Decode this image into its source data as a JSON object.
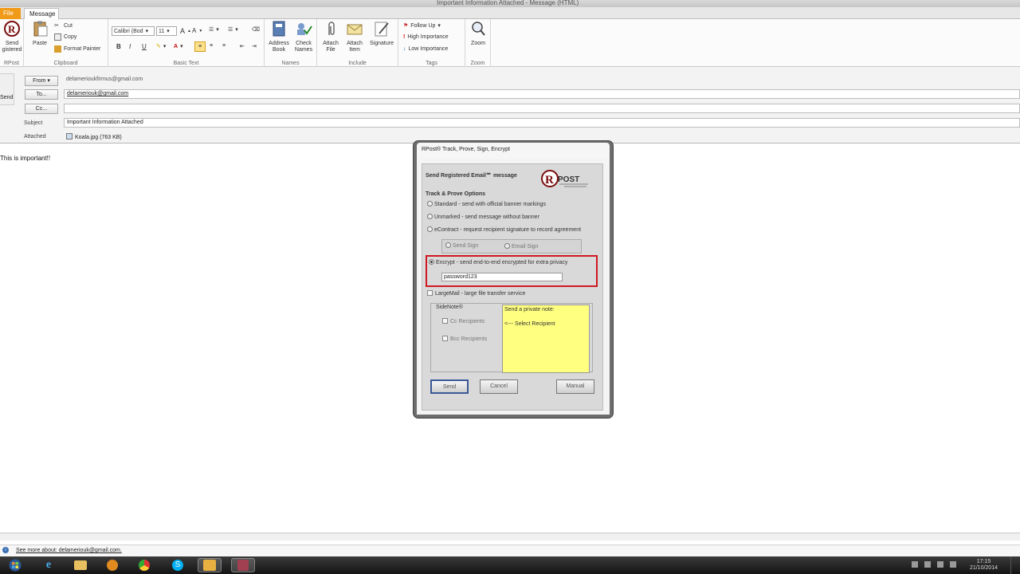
{
  "window": {
    "title": "Important Information Attached - Message (HTML)"
  },
  "tabs": {
    "file": "File",
    "message": "Message"
  },
  "ribbon": {
    "rpost": {
      "send_label": "Send",
      "send_label2": "gistered",
      "group": "RPost"
    },
    "clipboard": {
      "paste": "Paste",
      "cut": "Cut",
      "copy": "Copy",
      "format_painter": "Format Painter",
      "group": "Clipboard"
    },
    "basic_text": {
      "font": "Calibri (Bod",
      "size": "11",
      "group": "Basic Text"
    },
    "names": {
      "address_book": "Address",
      "address_book2": "Book",
      "check_names": "Check",
      "check_names2": "Names",
      "group": "Names"
    },
    "include": {
      "attach_file": "Attach",
      "attach_file2": "File",
      "attach_item": "Attach",
      "attach_item2": "Item",
      "signature": "Signature",
      "group": "Include"
    },
    "tags": {
      "follow_up": "Follow Up",
      "high": "High Importance",
      "low": "Low Importance",
      "group": "Tags"
    },
    "zoom": {
      "label": "Zoom",
      "group": "Zoom"
    }
  },
  "header": {
    "send_button": "Send",
    "from_button": "From",
    "from_value": "delamerioukfirmus@gmail.com",
    "to_button": "To...",
    "to_value": "delameriouk@gmail.com",
    "cc_button": "Cc...",
    "subject_label": "Subject",
    "subject_value": "Important Information Attached",
    "attached_label": "Attached",
    "attachment": "Koala.jpg (763 KB)"
  },
  "body": {
    "text": "This is important!!"
  },
  "dialog": {
    "title": "RPost® Track, Prove, Sign, Encrypt",
    "heading": "Send Registered Email℠ message",
    "section": "Track & Prove Options",
    "opt_standard": "Standard - send with official banner markings",
    "opt_unmarked": "Unmarked - send message without banner",
    "opt_econtract": "eContract - request recipient signature to record agreement",
    "opt_send_sign": "Send Sign",
    "opt_email_sign": "Email Sign",
    "opt_encrypt": "Encrypt - send end-to-end encrypted for extra privacy",
    "password": "password123",
    "opt_largemail": "LargeMail - large file transfer service",
    "sidenote_label": "SideNote®",
    "cc_recipients": "Cc Recipients",
    "bcc_recipients": "Bcc Recipients",
    "note_heading": "Send a private note:",
    "note_hint": "<--- Select Recipient",
    "btn_send": "Send",
    "btn_cancel": "Cancel",
    "btn_help": "Manual"
  },
  "status": {
    "see_more": "See more about: delameriouk@gmail.com."
  },
  "taskbar": {
    "time": "17:15",
    "date": "21/10/2014"
  },
  "colors": {
    "file_tab": "#f09a17",
    "encrypt_highlight": "#d01820",
    "note_bg": "#ffff80"
  }
}
